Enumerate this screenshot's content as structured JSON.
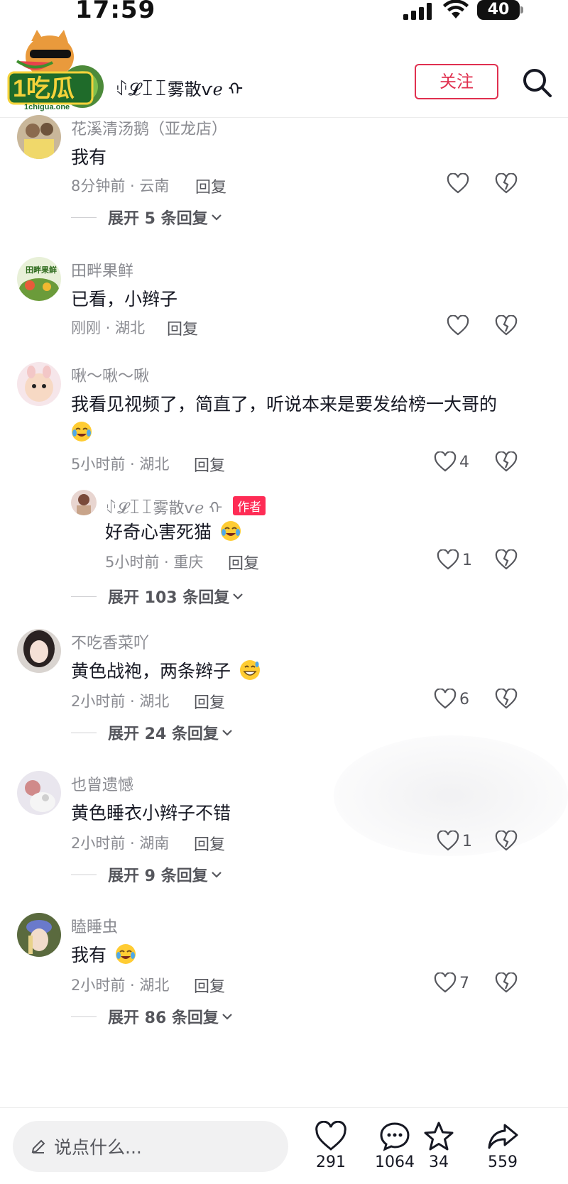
{
  "status_bar": {
    "time": "17:59",
    "battery": "40"
  },
  "header": {
    "logo_text": "1吃瓜",
    "logo_subtext": "1chigua.one",
    "author_name": "ꂑ𝓛ꀤꀤ雾散ѵℯ ᡣ",
    "follow_label": "关注",
    "colors": {
      "follow": "#e0304f",
      "author_badge": "#fe2c55"
    }
  },
  "comments": [
    {
      "name": "花溪清汤鹅（亚龙店）",
      "text": "我有",
      "meta": "8分钟前 · 云南",
      "reply_label": "回复",
      "likes": "",
      "expand": "展开 5 条回复"
    },
    {
      "name": "田畔果鲜",
      "text": "已看，小辫子",
      "meta": "刚刚 · 湖北",
      "reply_label": "回复",
      "likes": ""
    },
    {
      "name": "啾～啾～啾",
      "text": "我看见视频了，简直了，听说本来是要发给榜一大哥的",
      "meta": "5小时前 · 湖北",
      "reply_label": "回复",
      "likes": "4",
      "reply": {
        "name": "ꂑ𝓛ꀤꀤ雾散ѵℯ ᡣ",
        "badge": "作者",
        "text": "好奇心害死猫",
        "meta": "5小时前 · 重庆",
        "reply_label": "回复",
        "likes": "1"
      },
      "expand": "展开 103 条回复"
    },
    {
      "name": "不吃香菜吖",
      "text": "黄色战袍，两条辫子",
      "meta": "2小时前 · 湖北",
      "reply_label": "回复",
      "likes": "6",
      "expand": "展开 24 条回复"
    },
    {
      "name": "也曾遗憾",
      "text": "黄色睡衣小辫子不错",
      "meta": "2小时前 · 湖南",
      "reply_label": "回复",
      "likes": "1",
      "expand": "展开 9 条回复"
    },
    {
      "name": "瞌睡虫",
      "text": "我有",
      "meta": "2小时前 · 湖北",
      "reply_label": "回复",
      "likes": "7",
      "expand": "展开 86 条回复"
    }
  ],
  "bottom_bar": {
    "input_placeholder": "说点什么...",
    "likes": "291",
    "comments": "1064",
    "favorites": "34",
    "shares": "559"
  }
}
